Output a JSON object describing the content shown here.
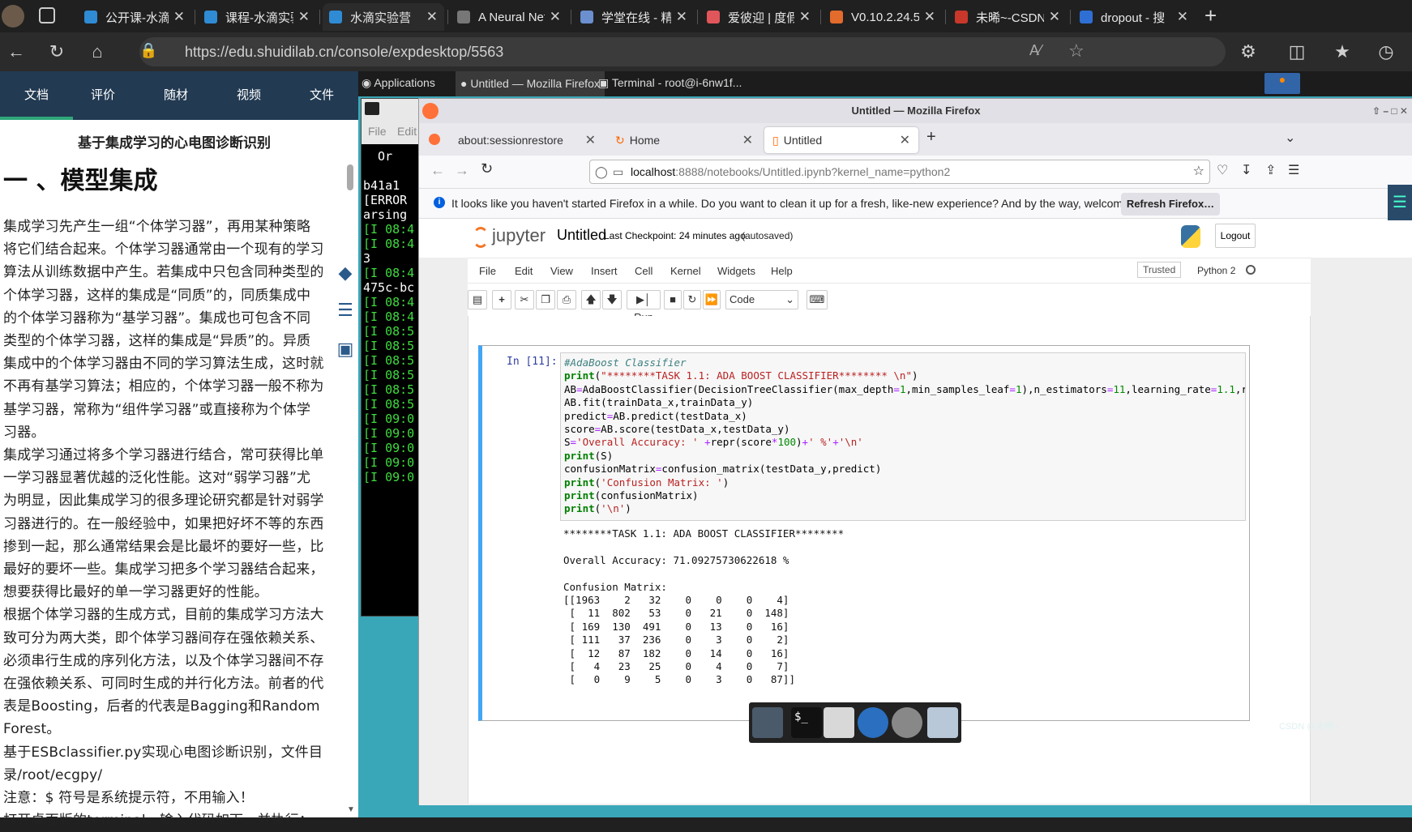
{
  "browser": {
    "tabs": [
      {
        "label": "公开课-水滴实",
        "color": "#2f8bd4"
      },
      {
        "label": "课程-水滴实验",
        "color": "#2f8bd4"
      },
      {
        "label": "水滴实验营",
        "color": "#2f8bd4"
      },
      {
        "label": "A Neural Net",
        "color": "#777"
      },
      {
        "label": "学堂在线 - 精",
        "color": "#6b8fcf"
      },
      {
        "label": "爱彼迎 | 度假",
        "color": "#e0565b"
      },
      {
        "label": "V0.10.2.24.5_",
        "color": "#e36b2c"
      },
      {
        "label": "未晞~-CSDN",
        "color": "#c8382a"
      },
      {
        "label": "dropout - 搜",
        "color": "#2f6fd4"
      }
    ],
    "url": "https://edu.shuidilab.cn/console/expdesktop/5563"
  },
  "doc": {
    "nav": [
      "文档",
      "评价",
      "随材",
      "视频",
      "文件"
    ],
    "title": "基于集成学习的心电图诊断识别",
    "heading": "一 、模型集成",
    "body": "集成学习先产生一组“个体学习器”，再用某种策略\n将它们结合起来。个体学习器通常由一个现有的学习\n算法从训练数据中产生。若集成中只包含同种类型的\n个体学习器，这样的集成是“同质”的，同质集成中\n的个体学习器称为“基学习器”。集成也可包含不同\n类型的个体学习器，这样的集成是“异质”的。异质\n集成中的个体学习器由不同的学习算法生成，这时就\n不再有基学习算法；相应的，个体学习器一般不称为\n基学习器，常称为“组件学习器”或直接称为个体学\n习器。\n集成学习通过将多个学习器进行结合，常可获得比单\n一学习器显著优越的泛化性能。这对“弱学习器”尤\n为明显，因此集成学习的很多理论研究都是针对弱学\n习器进行的。在一般经验中，如果把好坏不等的东西\n掺到一起，那么通常结果会是比最坏的要好一些，比\n最好的要坏一些。集成学习把多个学习器结合起来，\n想要获得比最好的单一学习器更好的性能。\n根据个体学习器的生成方式，目前的集成学习方法大\n致可分为两大类，即个体学习器间存在强依赖关系、\n必须串行生成的序列化方法，以及个体学习器间不存\n在强依赖关系、可同时生成的并行化方法。前者的代\n表是Boosting，后者的代表是Bagging和Random\nForest。\n基于ESBclassifier.py实现心电图诊断识别，文件目\n录/root/ecgpy/\n注意：$ 符号是系统提示符，不用输入！\n打开桌面版的terminal，输入代码如下，并执行："
  },
  "desktop": {
    "applications": "Applications",
    "task_firefox": "Untitled — Mozilla Firefox",
    "task_terminal": "Terminal - root@i-6nw1f...",
    "terminal": {
      "menu_file": "File",
      "menu_edit": "Edit",
      "lines": [
        "  Or",
        "",
        "b41a1",
        "[ERROR",
        "arsing",
        "[I 08:4",
        "[I 08:4",
        "3",
        "[I 08:4",
        "475c-bc",
        "[I 08:4",
        "[I 08:4",
        "[I 08:5",
        "[I 08:5",
        "[I 08:5",
        "[I 08:5",
        "[I 08:5",
        "[I 08:5",
        "[I 09:0",
        "[I 09:0",
        "[I 09:0",
        "[I 09:0",
        "[I 09:0"
      ]
    }
  },
  "firefox": {
    "title": "Untitled — Mozilla Firefox",
    "tabs": [
      "about:sessionrestore",
      "Home",
      "Untitled"
    ],
    "url_host": "localhost",
    "url_rest": ":8888/notebooks/Untitled.ipynb?kernel_name=python2",
    "notice": "It looks like you haven't started Firefox in a while. Do you want to clean it up for a fresh, like-new experience? And by the way, welcome back!",
    "refresh_btn": "Refresh Firefox…"
  },
  "jupyter": {
    "logo": "jupyter",
    "notebook_name": "Untitled",
    "checkpoint": "Last Checkpoint: 24 minutes ago",
    "autosave": "(autosaved)",
    "logout": "Logout",
    "menu": [
      "File",
      "Edit",
      "View",
      "Insert",
      "Cell",
      "Kernel",
      "Widgets",
      "Help"
    ],
    "trusted": "Trusted",
    "kernel": "Python 2",
    "run_label": "Run",
    "cell_type": "Code",
    "prompt": "In [11]:",
    "output": "********TASK 1.1: ADA BOOST CLASSIFIER********\n\nOverall Accuracy: 71.09275730622618 %\n\nConfusion Matrix:\n[[1963    2   32    0    0    0    4]\n [  11  802   53    0   21    0  148]\n [ 169  130  491    0   13    0   16]\n [ 111   37  236    0    3    0    2]\n [  12   87  182    0   14    0   16]\n [   4   23   25    0    4    0    7]\n [   0    9    5    0    3    0   87]]"
  },
  "watermark": "CSDN @未晞~"
}
